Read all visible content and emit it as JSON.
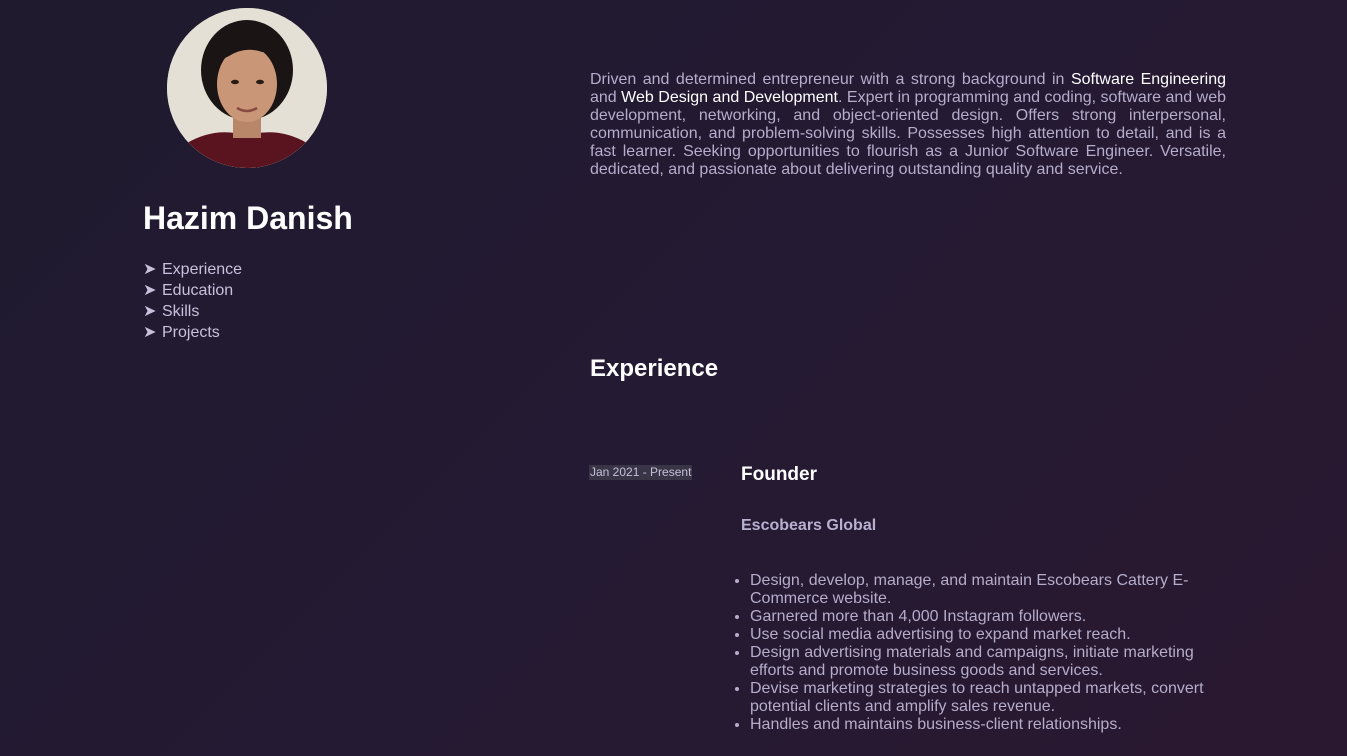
{
  "profile": {
    "name": "Hazim Danish",
    "avatar_icon": "profile-photo"
  },
  "nav": {
    "arrow": "➤",
    "items": [
      "Experience",
      "Education",
      "Skills",
      "Projects"
    ]
  },
  "about": {
    "p1": "Driven and determined entrepreneur with a strong background in ",
    "h1": "Software Engineering",
    "p2": " and ",
    "h2": "Web Design and Development",
    "p3": ". Expert in programming and coding, software and web development, networking, and object-oriented design. Offers strong interpersonal, communication, and problem-solving skills. Possesses high attention to detail, and is a fast learner. Seeking opportunities to flourish as a Junior Software Engineer. Versatile, dedicated, and passionate about delivering outstanding quality and service."
  },
  "experience": {
    "title": "Experience",
    "jobs": [
      {
        "date": "Jan 2021 - Present",
        "role": "Founder",
        "company": "Escobears Global",
        "duties": [
          "Design, develop, manage, and maintain Escobears Cattery E-Commerce website.",
          "Garnered more than 4,000 Instagram followers.",
          "Use social media advertising to expand market reach.",
          "Design advertising materials and campaigns, initiate marketing efforts and promote business goods and services.",
          "Devise marketing strategies to reach untapped markets, convert potential clients and amplify sales revenue.",
          "Handles and maintains business-client relationships."
        ]
      }
    ]
  },
  "colors": {
    "background": "#241a33",
    "heading": "#ffffff",
    "text": "#b5adcb"
  }
}
